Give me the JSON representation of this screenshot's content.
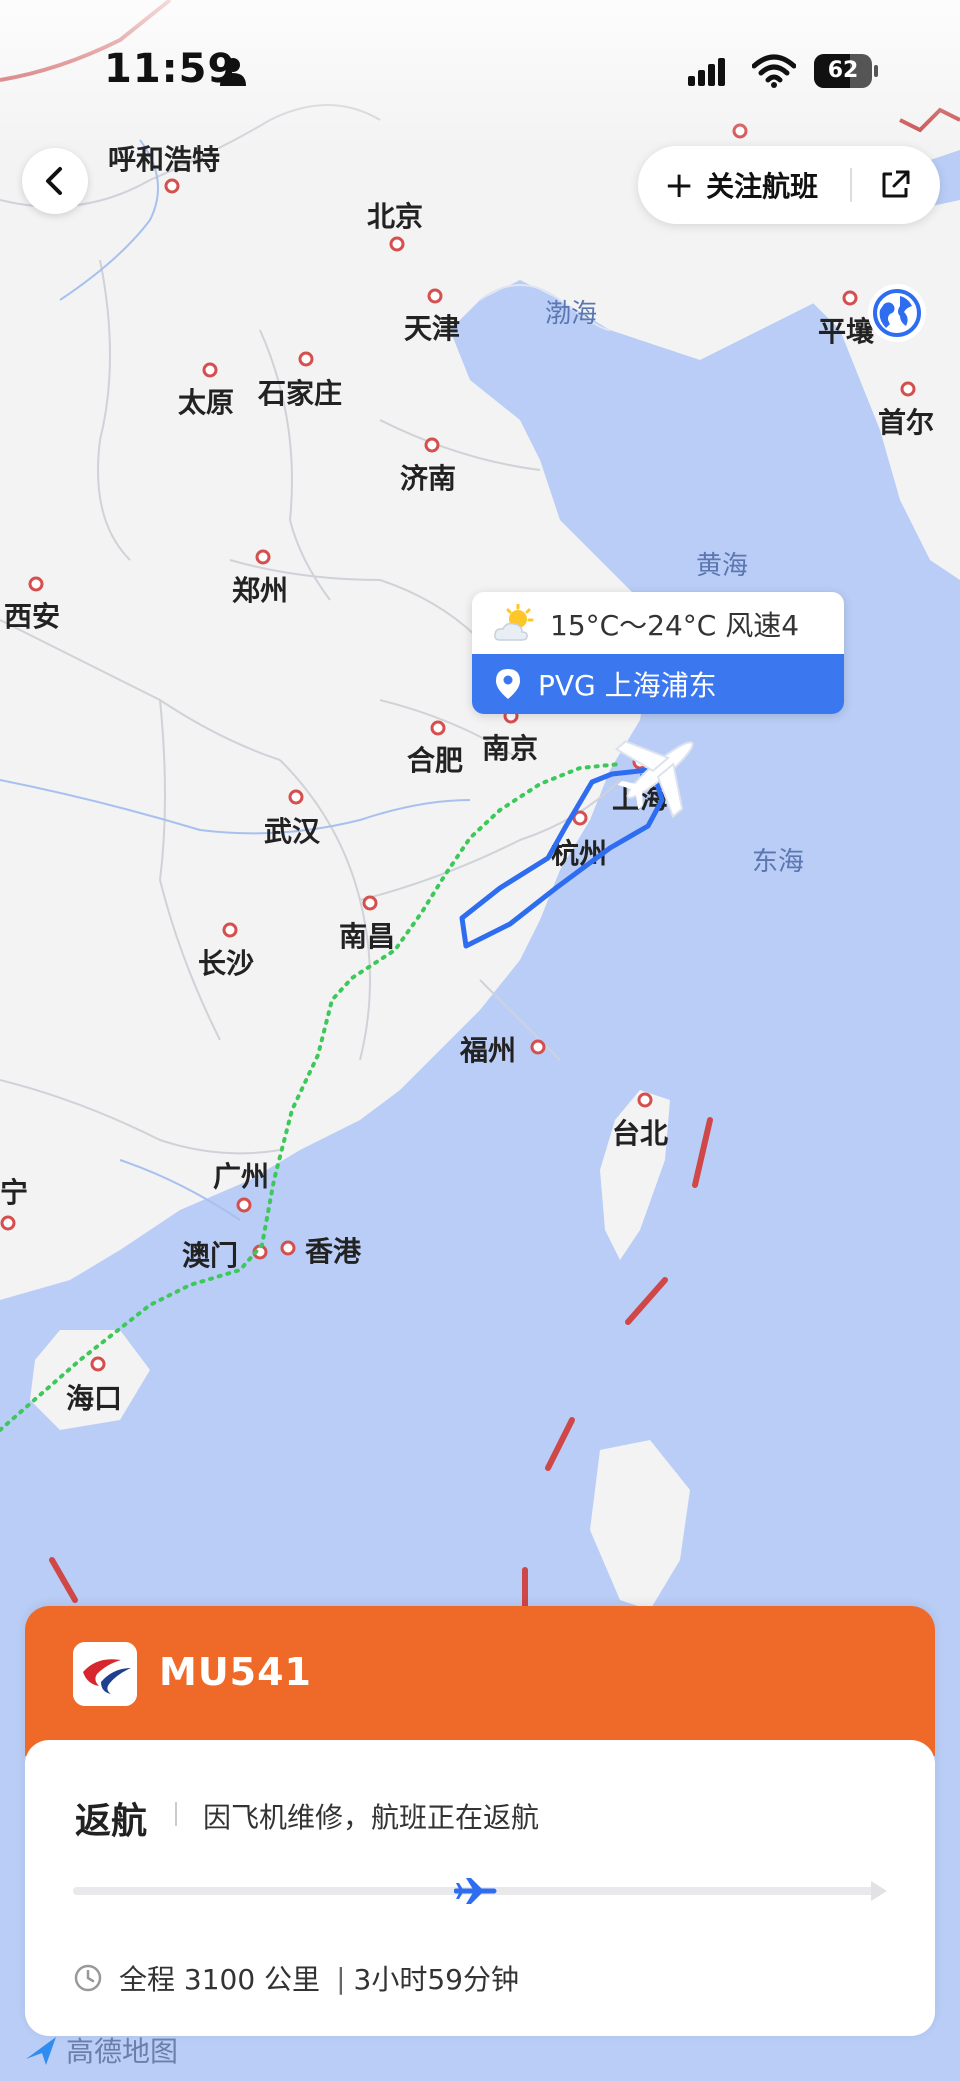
{
  "status_bar": {
    "time": "11:59",
    "battery": "62",
    "battery_level": 0.62
  },
  "header": {
    "follow_flight_label": "关注航班",
    "icons": [
      "back-icon",
      "plus-icon",
      "share-icon",
      "globe-icon"
    ]
  },
  "map": {
    "cities": [
      "呼和浩特",
      "北京",
      "天津",
      "太原",
      "石家庄",
      "济南",
      "西安",
      "郑州",
      "合肥",
      "南京",
      "上海",
      "杭州",
      "武汉",
      "长沙",
      "南昌",
      "福州",
      "台北",
      "广州",
      "澳门",
      "香港",
      "南宁",
      "海口",
      "平壤",
      "首尔"
    ],
    "seas": [
      "渤海",
      "黄海",
      "东海"
    ],
    "route_color": "#2f6df0",
    "planned_route_color": "#3cc95a"
  },
  "popup": {
    "weather": "15°C～24°C 风速4",
    "airport": "PVG 上海浦东"
  },
  "flight": {
    "number": "MU541",
    "status": "返航",
    "reason": "因飞机维修，航班正在返航",
    "distance": "全程 3100 公里",
    "duration": "3小时59分钟",
    "progress": 0.5,
    "header_color": "#ef6a28"
  },
  "footer": {
    "map_provider": "高德地图"
  }
}
